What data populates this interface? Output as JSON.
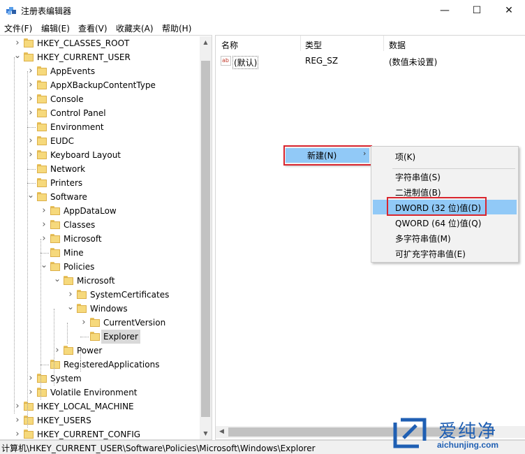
{
  "window": {
    "title": "注册表编辑器",
    "min": "—",
    "max": "☐",
    "close": "✕"
  },
  "menu": [
    "文件(F)",
    "编辑(E)",
    "查看(V)",
    "收藏夹(A)",
    "帮助(H)"
  ],
  "tree": [
    {
      "label": "HKEY_CLASSES_ROOT",
      "depth": 1,
      "expanded": false,
      "hasChildren": true
    },
    {
      "label": "HKEY_CURRENT_USER",
      "depth": 1,
      "expanded": true,
      "hasChildren": true
    },
    {
      "label": "AppEvents",
      "depth": 2,
      "expanded": false,
      "hasChildren": true
    },
    {
      "label": "AppXBackupContentType",
      "depth": 2,
      "expanded": false,
      "hasChildren": true
    },
    {
      "label": "Console",
      "depth": 2,
      "expanded": false,
      "hasChildren": true
    },
    {
      "label": "Control Panel",
      "depth": 2,
      "expanded": false,
      "hasChildren": true
    },
    {
      "label": "Environment",
      "depth": 2,
      "expanded": false,
      "hasChildren": false
    },
    {
      "label": "EUDC",
      "depth": 2,
      "expanded": false,
      "hasChildren": true
    },
    {
      "label": "Keyboard Layout",
      "depth": 2,
      "expanded": false,
      "hasChildren": true
    },
    {
      "label": "Network",
      "depth": 2,
      "expanded": false,
      "hasChildren": false
    },
    {
      "label": "Printers",
      "depth": 2,
      "expanded": false,
      "hasChildren": false
    },
    {
      "label": "Software",
      "depth": 2,
      "expanded": true,
      "hasChildren": true
    },
    {
      "label": "AppDataLow",
      "depth": 3,
      "expanded": false,
      "hasChildren": true
    },
    {
      "label": "Classes",
      "depth": 3,
      "expanded": false,
      "hasChildren": true
    },
    {
      "label": "Microsoft",
      "depth": 3,
      "expanded": false,
      "hasChildren": true
    },
    {
      "label": "Mine",
      "depth": 3,
      "expanded": false,
      "hasChildren": false
    },
    {
      "label": "Policies",
      "depth": 3,
      "expanded": true,
      "hasChildren": true
    },
    {
      "label": "Microsoft",
      "depth": 4,
      "expanded": true,
      "hasChildren": true
    },
    {
      "label": "SystemCertificates",
      "depth": 5,
      "expanded": false,
      "hasChildren": true
    },
    {
      "label": "Windows",
      "depth": 5,
      "expanded": true,
      "hasChildren": true
    },
    {
      "label": "CurrentVersion",
      "depth": 6,
      "expanded": false,
      "hasChildren": true
    },
    {
      "label": "Explorer",
      "depth": 6,
      "expanded": false,
      "hasChildren": false,
      "selected": true
    },
    {
      "label": "Power",
      "depth": 4,
      "expanded": false,
      "hasChildren": true
    },
    {
      "label": "RegisteredApplications",
      "depth": 3,
      "expanded": false,
      "hasChildren": false
    },
    {
      "label": "System",
      "depth": 2,
      "expanded": false,
      "hasChildren": true
    },
    {
      "label": "Volatile Environment",
      "depth": 2,
      "expanded": false,
      "hasChildren": true
    },
    {
      "label": "HKEY_LOCAL_MACHINE",
      "depth": 1,
      "expanded": false,
      "hasChildren": true
    },
    {
      "label": "HKEY_USERS",
      "depth": 1,
      "expanded": false,
      "hasChildren": true
    },
    {
      "label": "HKEY_CURRENT_CONFIG",
      "depth": 1,
      "expanded": false,
      "hasChildren": true
    }
  ],
  "list": {
    "columns": [
      "名称",
      "类型",
      "数据"
    ],
    "rows": [
      {
        "icon": "ab",
        "name": "(默认)",
        "type": "REG_SZ",
        "data": "(数值未设置)"
      }
    ]
  },
  "context_menu": {
    "new_label": "新建(N)",
    "new_chevron": "›"
  },
  "submenu": {
    "items": [
      "项(K)",
      "字符串值(S)",
      "二进制值(B)",
      "DWORD (32 位)值(D)",
      "QWORD (64 位)值(Q)",
      "多字符串值(M)",
      "可扩充字符串值(E)"
    ],
    "highlighted_index": 3
  },
  "status": "计算机\\HKEY_CURRENT_USER\\Software\\Policies\\Microsoft\\Windows\\Explorer",
  "watermark": {
    "cn": "爱纯净",
    "url": "aichunjing.com"
  },
  "colors": {
    "highlight": "#91c9f7",
    "annotation_red": "#d9252e",
    "folder": "#f6d97c",
    "watermark": "#1f5fb3"
  }
}
